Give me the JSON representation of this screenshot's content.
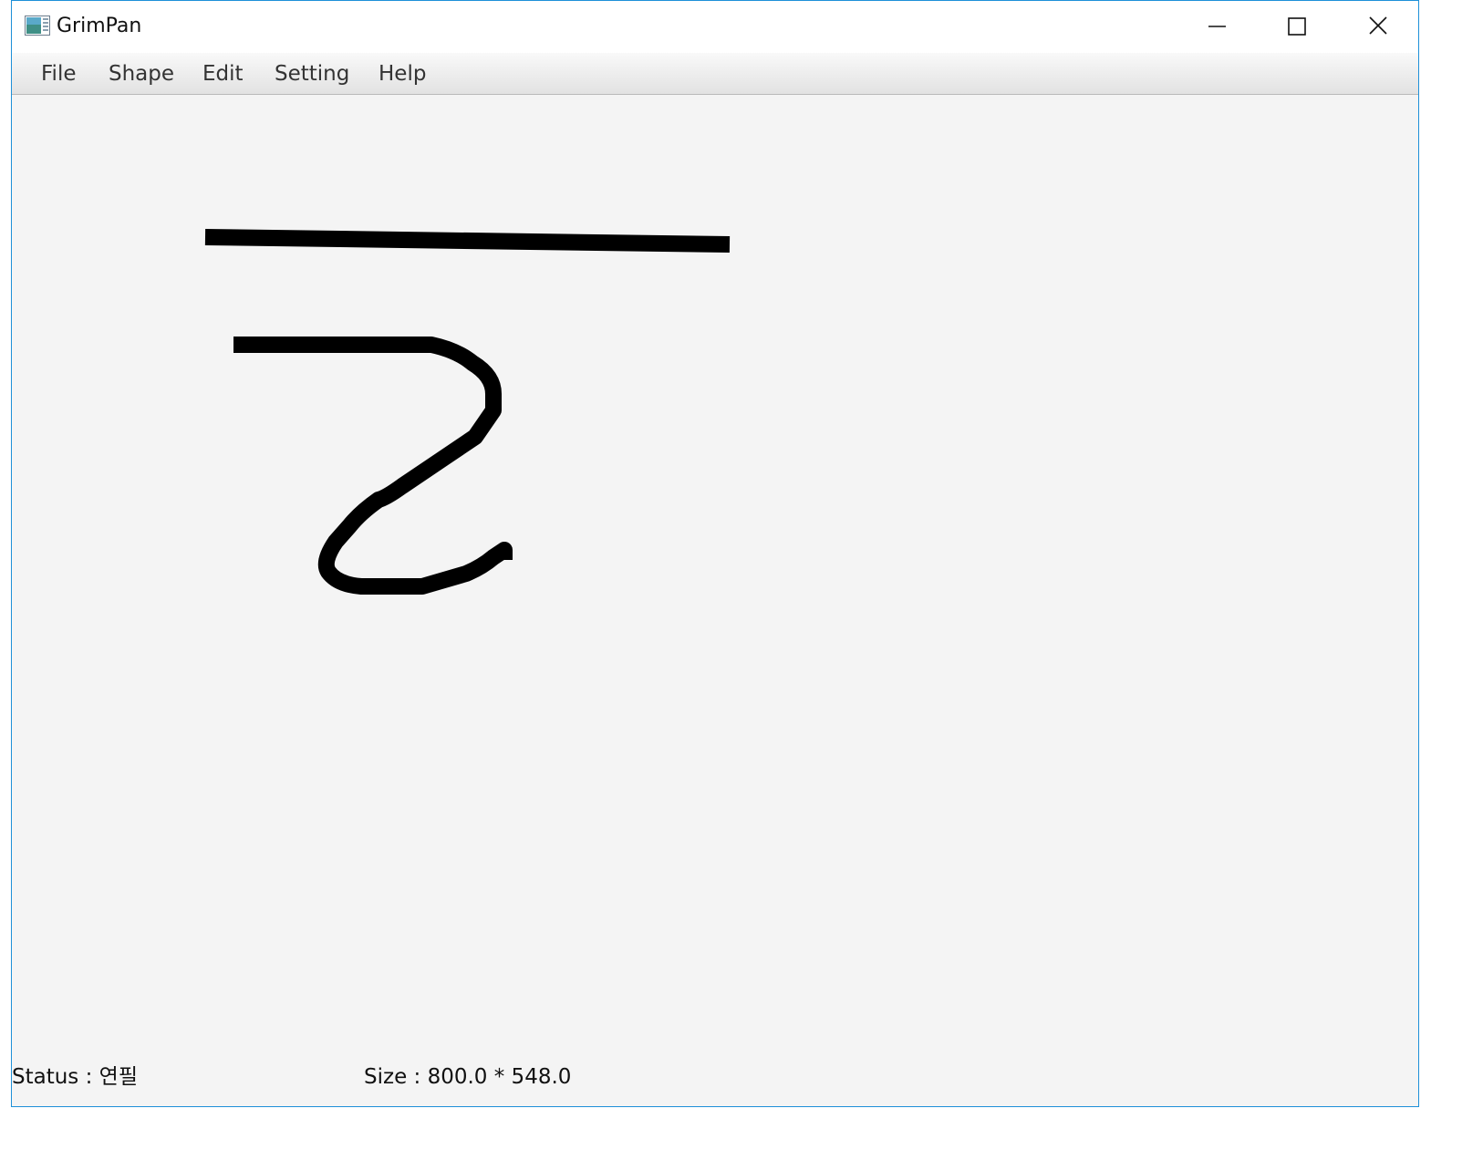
{
  "window": {
    "title": "GrimPan",
    "accent_border": "#1e90d8"
  },
  "icons": {
    "app": "app-icon",
    "minimize": "minimize-icon",
    "maximize": "maximize-icon",
    "close": "close-icon"
  },
  "menubar": {
    "items": [
      {
        "label": "File"
      },
      {
        "label": "Shape"
      },
      {
        "label": "Edit"
      },
      {
        "label": "Setting"
      },
      {
        "label": "Help"
      }
    ]
  },
  "canvas": {
    "background": "#f4f4f4",
    "stroke_color": "#000000",
    "shapes": [
      "line",
      "pencil-stroke"
    ]
  },
  "statusbar": {
    "status_prefix": "Status",
    "status_sep": " : ",
    "status_value": "연필",
    "size_prefix": "Size",
    "size_sep": " : ",
    "size_value": "800.0 * 548.0"
  }
}
